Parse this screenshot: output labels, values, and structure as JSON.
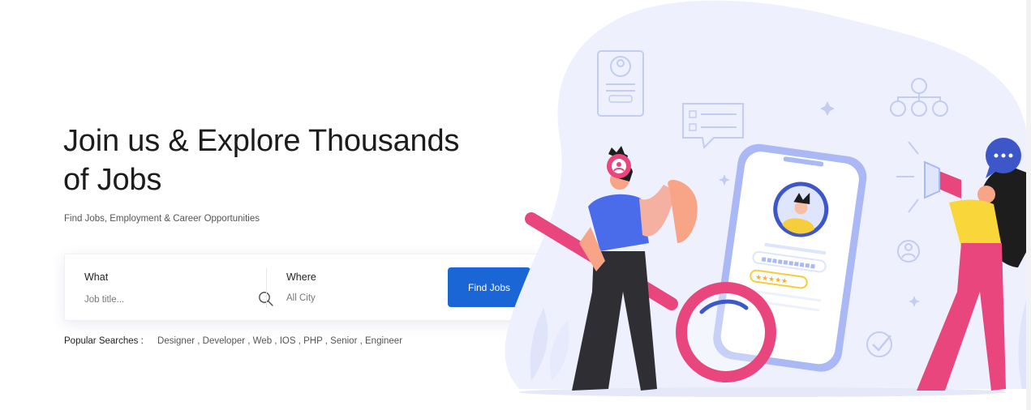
{
  "hero": {
    "title_line1": "Join us & Explore Thousands",
    "title_line2": "of Jobs",
    "subtitle": "Find Jobs, Employment & Career Opportunities"
  },
  "search": {
    "what_label": "What",
    "what_placeholder": "Job title...",
    "where_label": "Where",
    "where_value": "All City",
    "button_label": "Find Jobs"
  },
  "popular": {
    "label": "Popular Searches :",
    "tags": [
      "Designer",
      "Developer",
      "Web",
      "IOS",
      "PHP",
      "Senior",
      "Engineer"
    ]
  },
  "colors": {
    "primary": "#1b66d6",
    "accent_pink": "#e8467c",
    "illustration_blob": "#eef1fd"
  },
  "icons": [
    "search-icon",
    "chevron-down-icon",
    "location-pin-icon"
  ]
}
